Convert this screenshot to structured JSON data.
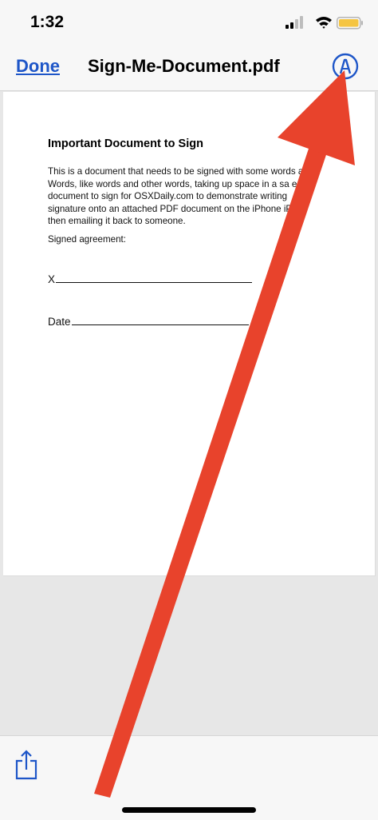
{
  "status_bar": {
    "time": "1:32",
    "icons": [
      "cellular-signal-icon",
      "wifi-icon",
      "battery-icon"
    ],
    "battery_color": "#f5c542"
  },
  "nav_bar": {
    "done_label": "Done",
    "title": "Sign-Me-Document.pdf",
    "markup_icon": "markup-pen-icon",
    "accent_color": "#1e56c8"
  },
  "document": {
    "heading": "Important Document to Sign",
    "body_lines": [
      "This is a document that needs to be signed with some words at.",
      "Words, like words and other words, taking up space in a sa e",
      "document to sign for OSXDaily.com to demonstrate writing",
      "signature onto an attached PDF document on the iPhone iPad",
      "then emailing it back to someone."
    ],
    "signed_label": "Signed agreement:",
    "x_label": "X",
    "date_label": "Date"
  },
  "toolbar": {
    "share_icon": "share-icon"
  },
  "overlay": {
    "arrow_color": "#e8432c"
  }
}
